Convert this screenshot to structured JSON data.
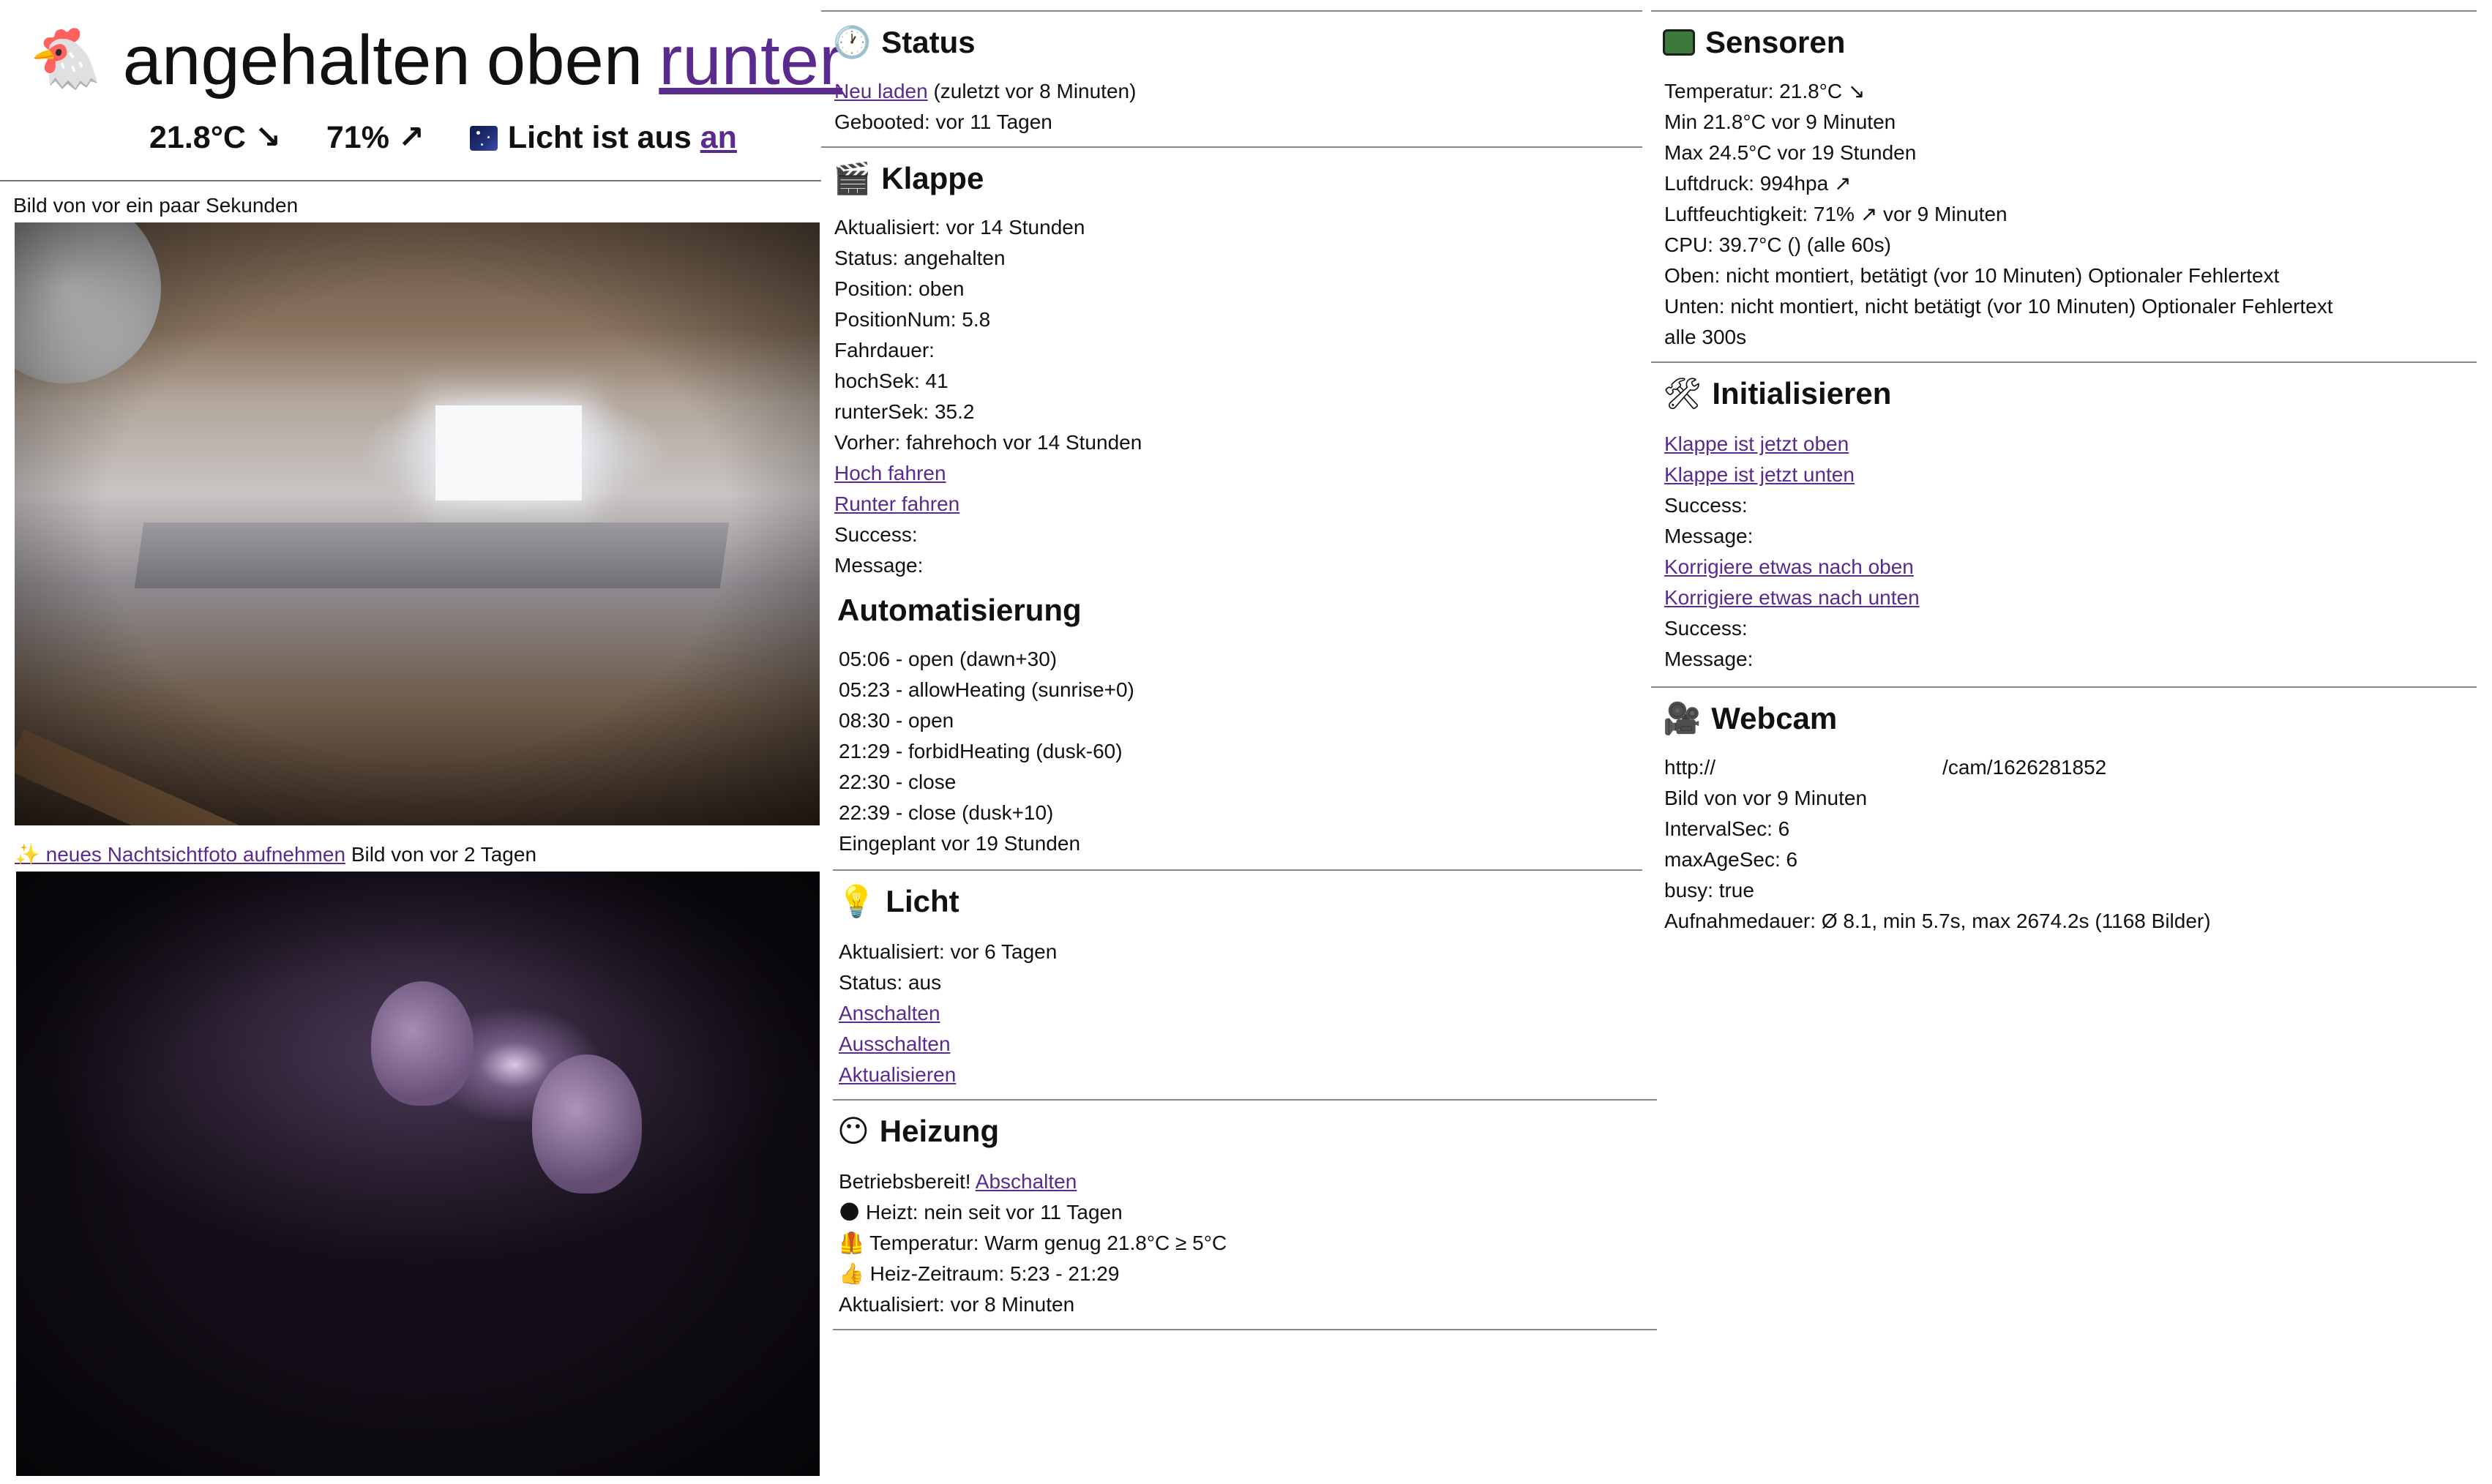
{
  "header": {
    "chicken_icon": "🐔",
    "state_word": "angehalten",
    "position_word": "oben",
    "action_link": "runter",
    "temperature": "21.8°C ↘",
    "humidity": "71% ↗",
    "light_icon": "night-sky-icon",
    "light_text": "Licht ist aus",
    "light_link": "an"
  },
  "cameras": {
    "day_caption": "Bild von vor ein paar Sekunden",
    "night_link": "✨ neues Nachtsichtfoto aufnehmen",
    "night_caption": "Bild von vor 2 Tagen"
  },
  "status": {
    "icon": "🕐",
    "title": "Status",
    "reload_link": "Neu laden",
    "reload_note": "(zuletzt vor 8 Minuten)",
    "booted": "Gebooted: vor 11 Tagen"
  },
  "klappe": {
    "icon": "🎬",
    "title": "Klappe",
    "lines": [
      "Aktualisiert: vor 14 Stunden",
      "Status: angehalten",
      "Position: oben",
      "PositionNum: 5.8",
      "Fahrdauer:",
      "hochSek: 41",
      "runterSek: 35.2",
      "Vorher: fahrehoch vor 14 Stunden"
    ],
    "up_link": "Hoch fahren",
    "down_link": "Runter fahren",
    "success": "Success:",
    "message": "Message:"
  },
  "automation": {
    "title": "Automatisierung",
    "lines": [
      "05:06 - open (dawn+30)",
      "05:23 - allowHeating (sunrise+0)",
      "08:30 - open",
      "21:29 - forbidHeating (dusk-60)",
      "22:30 - close",
      "22:39 - close (dusk+10)",
      "Eingeplant vor 19 Stunden"
    ]
  },
  "licht": {
    "icon": "💡",
    "title": "Licht",
    "updated": "Aktualisiert: vor 6 Tagen",
    "status": "Status: aus",
    "on_link": "Anschalten",
    "off_link": "Ausschalten",
    "refresh_link": "Aktualisieren"
  },
  "heizung": {
    "icon": "😶",
    "title": "Heizung",
    "ready": "Betriebsbereit!",
    "off_link": "Abschalten",
    "heating": "🌑 Heizt: nein seit vor 11 Tagen",
    "temperature": "🦺 Temperatur: Warm genug 21.8°C ≥ 5°C",
    "period": "👍 Heiz-Zeitraum: 5:23 - 21:29",
    "updated": "Aktualisiert: vor 8 Minuten"
  },
  "sensoren": {
    "icon": "sensor-board-icon",
    "title": "Sensoren",
    "lines": [
      "Temperatur: 21.8°C ↘",
      "Min 21.8°C vor 9 Minuten",
      "Max 24.5°C vor 19 Stunden",
      "Luftdruck: 994hpa ↗",
      "Luftfeuchtigkeit: 71% ↗ vor 9 Minuten",
      "CPU: 39.7°C () (alle 60s)",
      "Oben: nicht montiert, betätigt (vor 10 Minuten) Optionaler Fehlertext",
      "Unten: nicht montiert, nicht betätigt (vor 10 Minuten) Optionaler Fehlertext",
      "alle 300s"
    ]
  },
  "initialisieren": {
    "icon": "🛠",
    "title": "Initialisieren",
    "top_link": "Klappe ist jetzt oben",
    "bottom_link": "Klappe ist jetzt unten",
    "success1": "Success:",
    "message1": "Message:",
    "correct_up_link": "Korrigiere etwas nach oben",
    "correct_down_link": "Korrigiere etwas nach unten",
    "success2": "Success:",
    "message2": "Message:"
  },
  "webcam": {
    "icon": "🎥",
    "title": "Webcam",
    "url_prefix": "http://",
    "url_suffix": "/cam/1626281852",
    "lines": [
      "Bild von vor 9 Minuten",
      "IntervalSec: 6",
      "maxAgeSec: 6",
      "busy: true",
      "Aufnahmedauer: Ø 8.1, min 5.7s, max 2674.2s (1168 Bilder)"
    ]
  },
  "colors": {
    "link": "#5a2a8e",
    "divider": "#8a8a8a"
  }
}
